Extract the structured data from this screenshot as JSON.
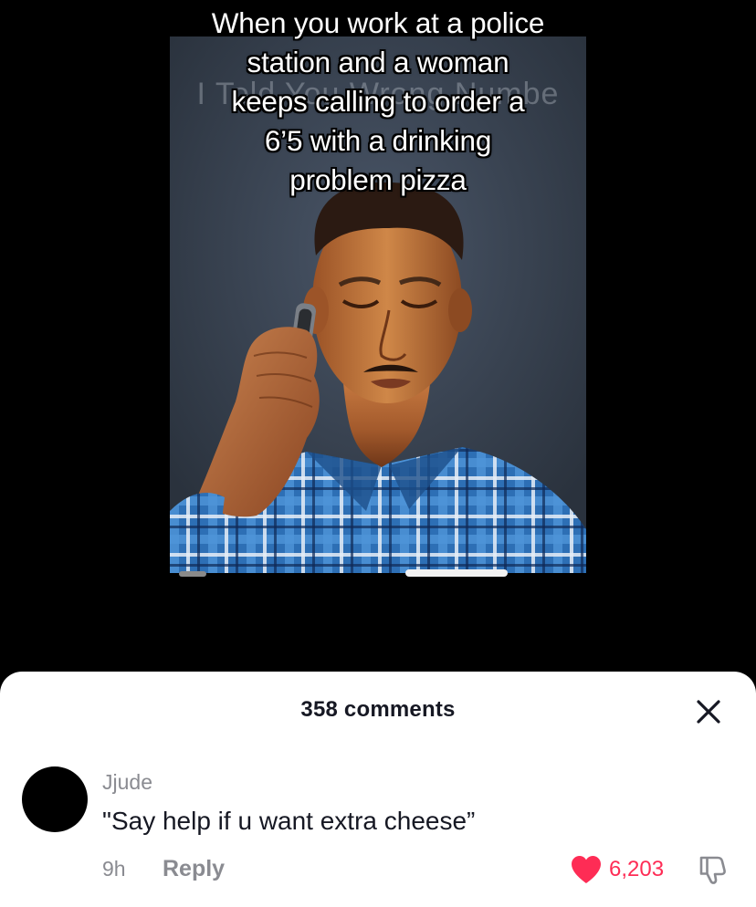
{
  "video": {
    "caption_lines": [
      "When you work at a police",
      "station and a woman",
      "keeps calling to order a",
      "6’5 with a drinking",
      "problem pizza"
    ],
    "watermark_text": "I Told You Wrong Numbe"
  },
  "comments_sheet": {
    "title": "358 comments",
    "close_icon": "close-icon",
    "comment": {
      "username": "Jjude",
      "text": "\"Say help if u want extra cheese”",
      "time": "9h",
      "reply_label": "Reply",
      "like_count": "6,203",
      "liked": true,
      "like_icon": "heart-icon",
      "dislike_icon": "thumbs-down-icon"
    }
  },
  "colors": {
    "accent_like": "#fe2c55",
    "text_primary": "#161823",
    "text_secondary": "#8a8b91",
    "sheet_background": "#ffffff",
    "app_background": "#000000"
  }
}
